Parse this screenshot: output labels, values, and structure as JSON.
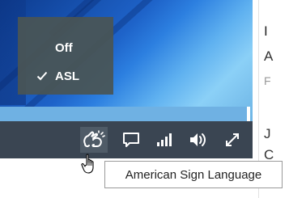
{
  "caption_menu": {
    "items": [
      {
        "label": "Off",
        "selected": false
      },
      {
        "label": "ASL",
        "selected": true
      }
    ]
  },
  "controls": [
    {
      "icon": "sign-language-icon",
      "active": true
    },
    {
      "icon": "captions-icon",
      "active": false
    },
    {
      "icon": "quality-icon",
      "active": false
    },
    {
      "icon": "volume-icon",
      "active": false
    },
    {
      "icon": "fullscreen-icon",
      "active": false
    }
  ],
  "tooltip": {
    "text": "American Sign Language"
  },
  "right_panel": {
    "fragments": [
      "I",
      "A",
      "F",
      "J",
      "C"
    ]
  },
  "colors": {
    "control_bar": "#3a4552",
    "menu_bg": "#4a5554",
    "progress": "#6fb1e3"
  }
}
